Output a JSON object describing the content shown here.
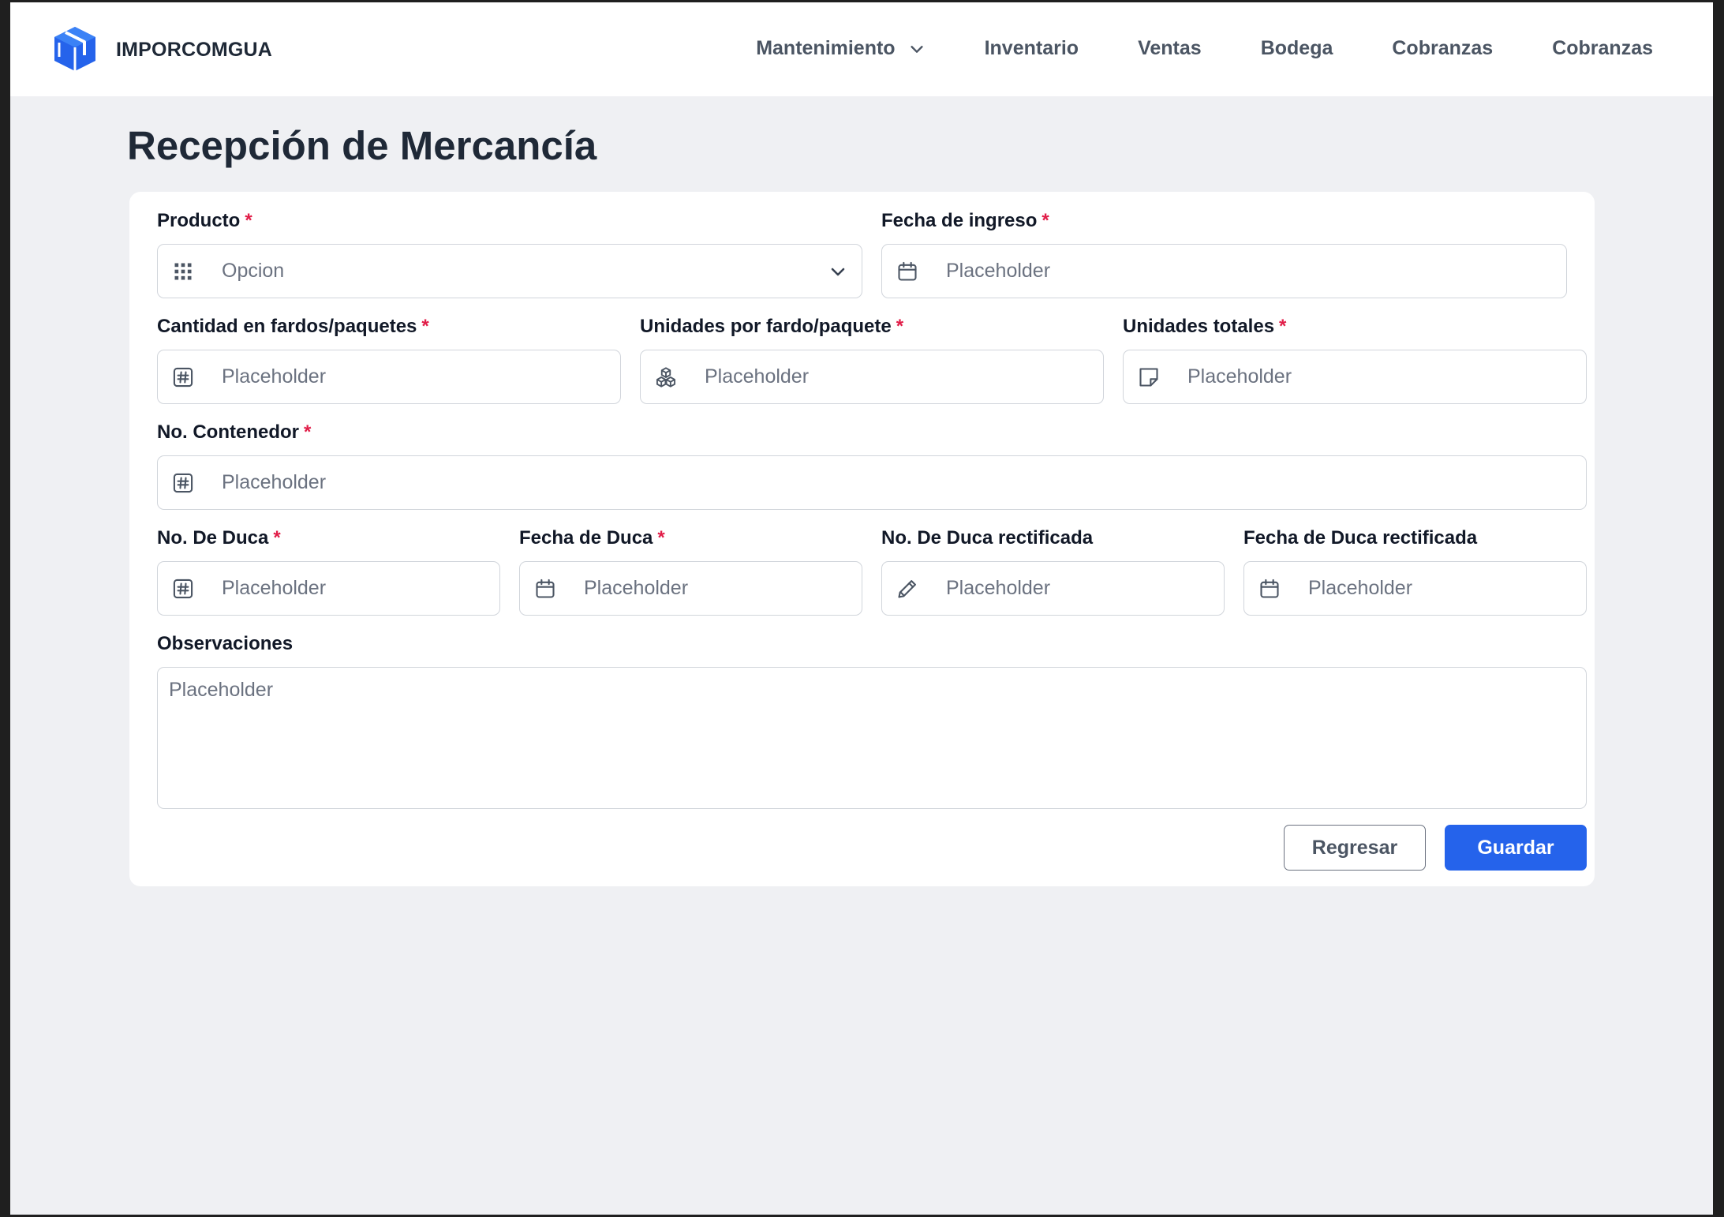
{
  "header": {
    "brand": "IMPORCOMGUA",
    "nav": [
      {
        "label": "Mantenimiento",
        "has_dropdown": true
      },
      {
        "label": "Inventario"
      },
      {
        "label": "Ventas"
      },
      {
        "label": "Bodega"
      },
      {
        "label": "Cobranzas"
      },
      {
        "label": "Cobranzas"
      }
    ]
  },
  "page": {
    "title": "Recepción de Mercancía"
  },
  "form": {
    "required_mark": "*",
    "producto": {
      "label": "Producto",
      "placeholder": "Opcion",
      "icon": "grid-icon"
    },
    "fecha_ingreso": {
      "label": "Fecha de ingreso",
      "placeholder": "Placeholder",
      "icon": "calendar-icon"
    },
    "cantidad_fardos": {
      "label": "Cantidad en fardos/paquetes",
      "placeholder": "Placeholder",
      "icon": "hash-icon"
    },
    "unidades_fardo": {
      "label": "Unidades por fardo/paquete",
      "placeholder": "Placeholder",
      "icon": "cubes-icon"
    },
    "unidades_totales": {
      "label": "Unidades totales",
      "placeholder": "Placeholder",
      "icon": "note-icon"
    },
    "no_contenedor": {
      "label": "No. Contenedor",
      "placeholder": "Placeholder",
      "icon": "hash-icon"
    },
    "no_duca": {
      "label": "No. De Duca",
      "placeholder": "Placeholder",
      "icon": "hash-icon"
    },
    "fecha_duca": {
      "label": "Fecha de Duca",
      "placeholder": "Placeholder",
      "icon": "calendar-icon"
    },
    "no_duca_rect": {
      "label": "No. De Duca rectificada",
      "placeholder": "Placeholder",
      "icon": "pencil-icon"
    },
    "fecha_duca_rect": {
      "label": "Fecha de Duca rectificada",
      "placeholder": "Placeholder",
      "icon": "calendar-icon"
    },
    "observaciones": {
      "label": "Observaciones",
      "placeholder": "Placeholder"
    },
    "buttons": {
      "back": "Regresar",
      "save": "Guardar"
    }
  },
  "colors": {
    "accent": "#2563eb",
    "required": "#e11d48",
    "page_bg": "#eff0f3"
  }
}
